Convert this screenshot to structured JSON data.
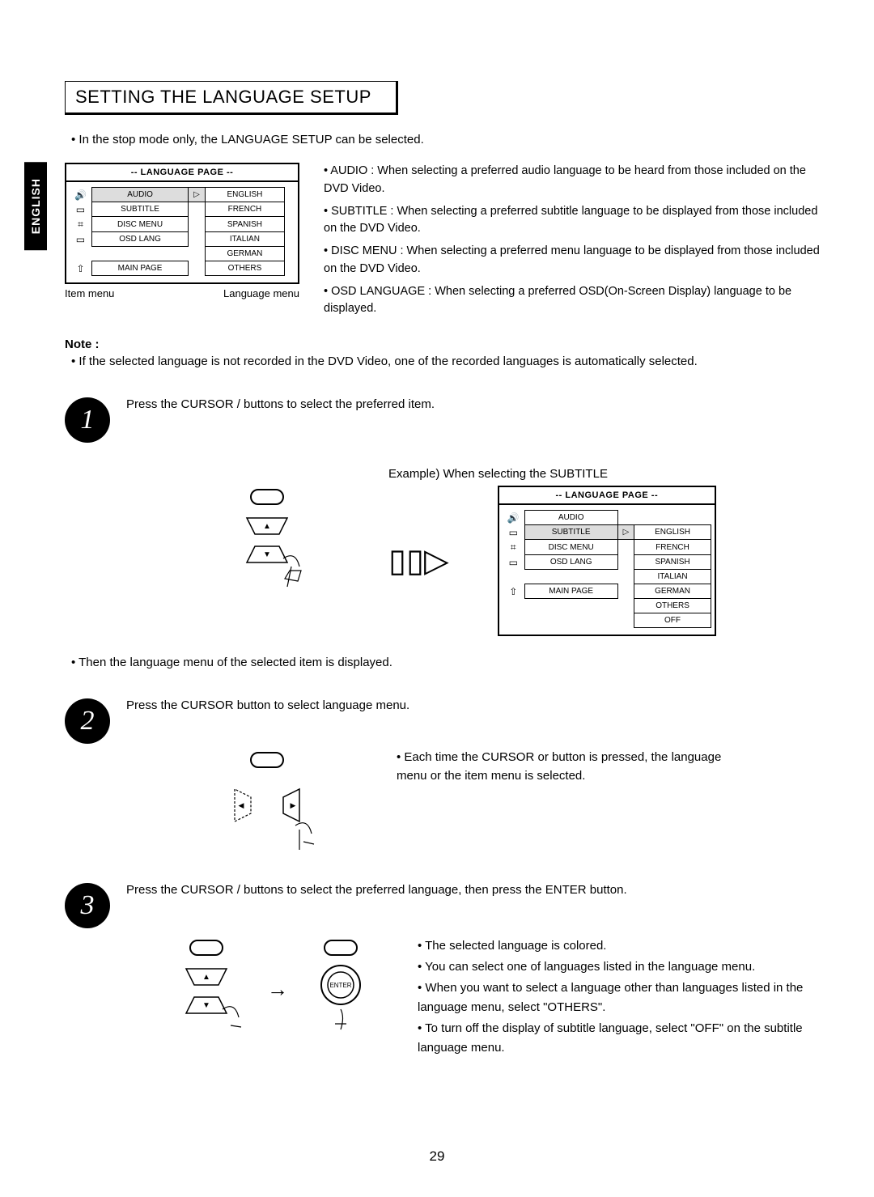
{
  "page_tab": "ENGLISH",
  "title": "SETTING THE LANGUAGE SETUP",
  "intro_bullet": "• In the stop mode only, the LANGUAGE SETUP can be selected.",
  "menu1": {
    "header": "-- LANGUAGE PAGE --",
    "items": [
      "AUDIO",
      "SUBTITLE",
      "DISC MENU",
      "OSD LANG",
      "",
      "MAIN PAGE"
    ],
    "langs": [
      "ENGLISH",
      "FRENCH",
      "SPANISH",
      "ITALIAN",
      "GERMAN",
      "OTHERS"
    ],
    "left_label": "Item menu",
    "right_label": "Language menu"
  },
  "descriptions": [
    "• AUDIO : When selecting a preferred audio language to be heard from those included on the DVD Video.",
    "• SUBTITLE : When selecting a preferred subtitle language to be displayed from those included on the DVD Video.",
    "• DISC MENU : When selecting a preferred menu language to be displayed from those included on the DVD Video.",
    "• OSD LANGUAGE : When selecting a preferred OSD(On-Screen Display) language to be displayed."
  ],
  "note_head": "Note :",
  "note_body": "• If the selected language is not recorded in the DVD Video, one of the recorded languages is automatically selected.",
  "step1": {
    "num": "1",
    "text": "Press the CURSOR     /     buttons to select the preferred item.",
    "example_label": "Example) When selecting the SUBTITLE",
    "menu": {
      "header": "-- LANGUAGE PAGE --",
      "items": [
        "AUDIO",
        "SUBTITLE",
        "DISC MENU",
        "OSD LANG",
        "",
        "MAIN PAGE"
      ],
      "langs": [
        "ENGLISH",
        "FRENCH",
        "SPANISH",
        "ITALIAN",
        "GERMAN",
        "OTHERS",
        "OFF"
      ]
    },
    "after": "• Then the language menu of the selected item is displayed."
  },
  "step2": {
    "num": "2",
    "text": "Press the CURSOR      button to select language menu.",
    "right": "• Each time the CURSOR      or      button is pressed, the language menu or the item menu is selected."
  },
  "step3": {
    "num": "3",
    "text": "Press the CURSOR     /     buttons to select the preferred language, then press the ENTER button.",
    "enter_label": "ENTER",
    "notes": [
      "• The selected language is colored.",
      "• You can select one of languages listed in the language menu.",
      "• When you want to select a language other than languages listed in the language menu, select \"OTHERS\".",
      "• To turn off the display of subtitle language, select \"OFF\" on the subtitle language menu."
    ]
  },
  "page_number": "29"
}
